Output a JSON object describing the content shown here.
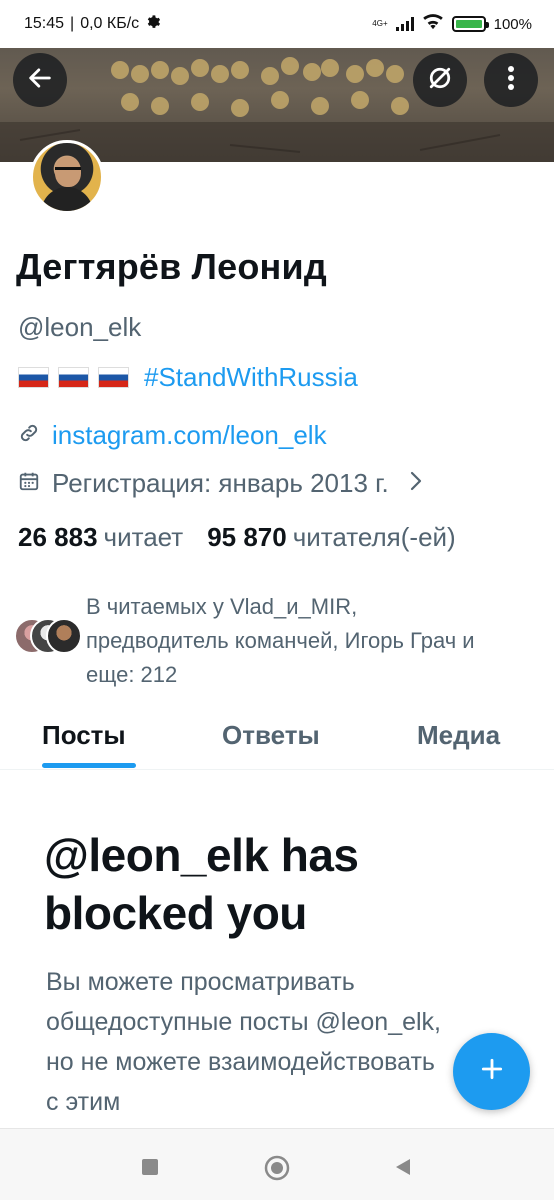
{
  "status_bar": {
    "time": "15:45",
    "speed": "0,0 КБ/с",
    "network": "4G+",
    "battery": "100%"
  },
  "profile": {
    "name": "Дегтярёв Леонид",
    "handle": "@leon_elk",
    "bio_hashtag": "#StandWithRussia",
    "link": "instagram.com/leon_elk",
    "joined": "Регистрация: январь 2013 г.",
    "following_count": "26 883",
    "following_label": "читает",
    "followers_count": "95 870",
    "followers_label": "читателя(-ей)",
    "followed_by": "В читаемых у Vlad_и_MIR, предводитель команчей, Игорь Грач и еще: 212"
  },
  "tabs": [
    {
      "label": "Посты",
      "active": true
    },
    {
      "label": "Ответы",
      "active": false
    },
    {
      "label": "Медиа",
      "active": false
    }
  ],
  "blocked": {
    "title": "@leon_elk has blocked you",
    "message": "Вы можете просматривать общедоступные посты @leon_elk, но не можете взаимодействовать с этим"
  },
  "colors": {
    "accent": "#1d9bf0",
    "text": "#0f1419",
    "muted": "#536471"
  },
  "icons": {
    "back": "arrow-left-icon",
    "hide": "eye-off-icon",
    "more": "more-vertical-icon",
    "link": "link-icon",
    "calendar": "calendar-icon",
    "chevron": "chevron-right-icon",
    "compose": "plus-icon"
  }
}
